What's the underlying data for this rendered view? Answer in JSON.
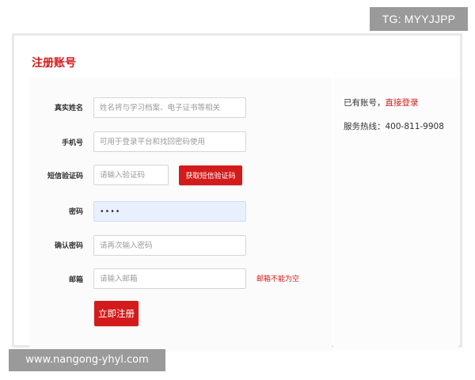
{
  "watermark_top": "TG: MYYJJPP",
  "watermark_bottom": "www.nangong-yhyl.com",
  "title": "注册账号",
  "form": {
    "real_name": {
      "label": "真实姓名",
      "placeholder": "姓名将与学习档案、电子证书等相关",
      "value": ""
    },
    "phone": {
      "label": "手机号",
      "placeholder": "可用于登录平台和找回密码使用",
      "value": ""
    },
    "sms_code": {
      "label": "短信验证码",
      "placeholder": "请输入验证码",
      "value": "",
      "button_label": "获取短信验证码"
    },
    "password": {
      "label": "密码",
      "placeholder": "",
      "value": "••••"
    },
    "confirm_password": {
      "label": "确认密码",
      "placeholder": "请再次输入密码",
      "value": ""
    },
    "email": {
      "label": "邮箱",
      "placeholder": "请输入邮箱",
      "value": "",
      "error": "邮箱不能为空"
    },
    "submit_label": "立即注册"
  },
  "side": {
    "have_account_text": "已有账号，",
    "login_link_text": "直接登录",
    "hotline_label": "服务热线：",
    "hotline_number": "400-811-9908"
  },
  "colors": {
    "accent": "#d21a1a",
    "watermark_bg": "#9a9a9a",
    "password_fill": "#e8f0fe"
  }
}
